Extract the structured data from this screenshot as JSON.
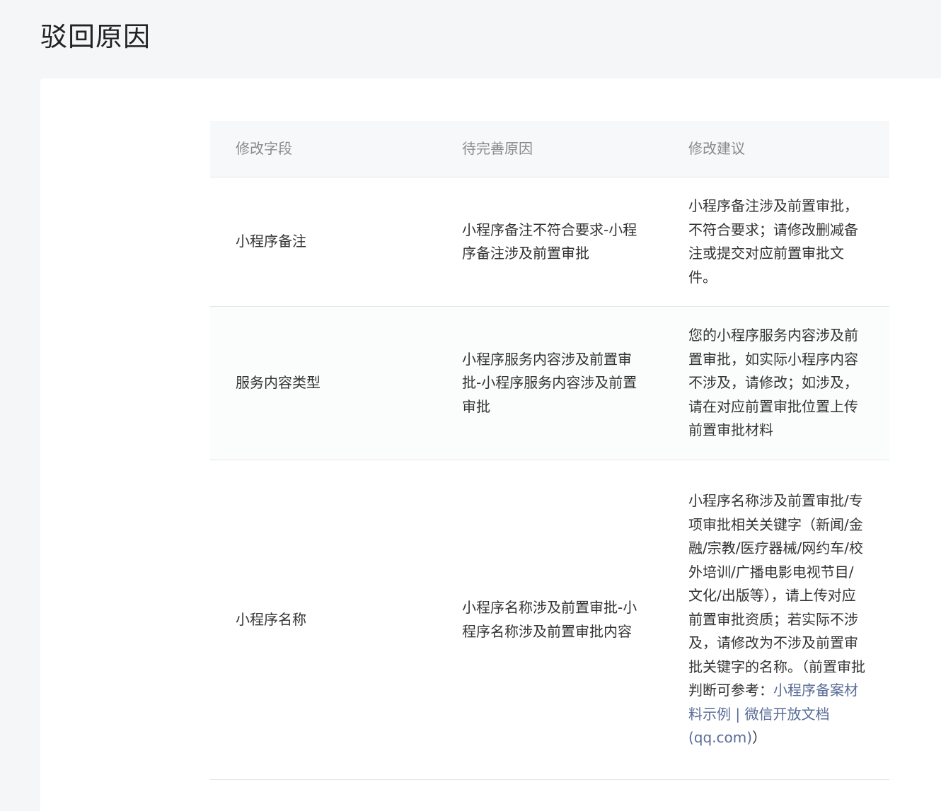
{
  "page": {
    "title": "驳回原因"
  },
  "table": {
    "headers": [
      "修改字段",
      "待完善原因",
      "修改建议"
    ],
    "rows": [
      {
        "field": "小程序备注",
        "reason": "小程序备注不符合要求-小程序备注涉及前置审批",
        "suggestion": "小程序备注涉及前置审批，不符合要求；请修改删减备注或提交对应前置审批文件。"
      },
      {
        "field": "服务内容类型",
        "reason": "小程序服务内容涉及前置审批-小程序服务内容涉及前置审批",
        "suggestion": "您的小程序服务内容涉及前置审批，如实际小程序内容不涉及，请修改；如涉及，请在对应前置审批位置上传前置审批材料"
      },
      {
        "field": "小程序名称",
        "reason": "小程序名称涉及前置审批-小程序名称涉及前置审批内容",
        "suggestion_prefix": "小程序名称涉及前置审批/专项审批相关关键字（新闻/金融/宗教/医疗器械/网约车/校外培训/广播电影电视节目/文化/出版等），请上传对应前置审批资质；若实际不涉及，请修改为不涉及前置审批关键字的名称。（前置审批判断可参考：",
        "suggestion_link": "小程序备案材料示例 | 微信开放文档 (qq.com)",
        "suggestion_suffix": "）"
      }
    ]
  },
  "colors": {
    "background": "#f5f6f7",
    "card": "#ffffff",
    "header_bg": "#f6f8f9",
    "link": "#576b95"
  }
}
